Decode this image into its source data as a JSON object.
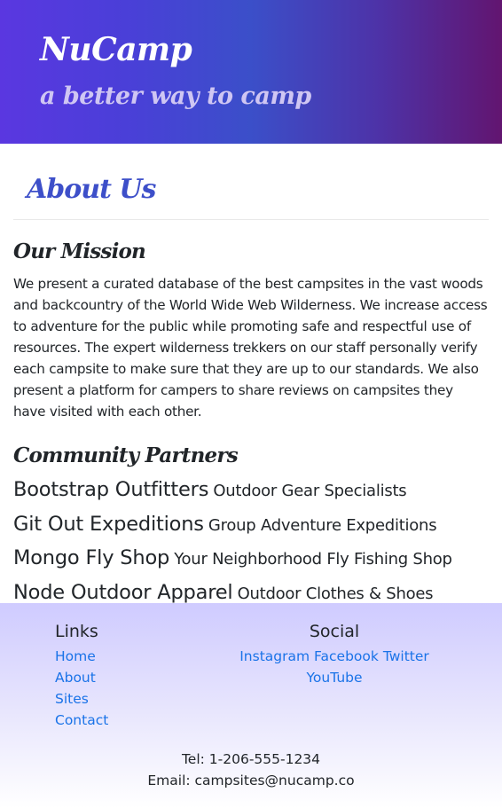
{
  "header": {
    "brand": "NuCamp",
    "tagline": "a better way to camp"
  },
  "main": {
    "title": "About Us",
    "mission": {
      "heading": "Our Mission",
      "text": "We present a curated database of the best campsites in the vast woods and backcountry of the World Wide Web Wilderness. We increase access to adventure for the public while promoting safe and respectful use of resources. The expert wilderness trekkers on our staff personally verify each campsite to make sure that they are up to our standards. We also present a platform for campers to share reviews on campsites they have visited with each other."
    },
    "partners": {
      "heading": "Community Partners",
      "items": [
        {
          "name": "Bootstrap Outfitters",
          "description": "Outdoor Gear Specialists"
        },
        {
          "name": "Git Out Expeditions",
          "description": "Group Adventure Expeditions"
        },
        {
          "name": "Mongo Fly Shop",
          "description": "Your Neighborhood Fly Fishing Shop"
        },
        {
          "name": "Node Outdoor Apparel",
          "description": "Outdoor Clothes & Shoes"
        }
      ]
    }
  },
  "footer": {
    "links_heading": "Links",
    "links": [
      "Home",
      "About",
      "Sites",
      "Contact"
    ],
    "social_heading": "Social",
    "social": [
      "Instagram",
      "Facebook",
      "Twitter",
      "YouTube"
    ],
    "tel": "Tel: 1-206-555-1234",
    "email": "Email: campsites@nucamp.co"
  },
  "colors": {
    "link": "#1a73e8",
    "title_accent": "#3d4fc9",
    "header_gradient_start": "#5a37e0",
    "header_gradient_end": "#621570",
    "footer_gradient_top": "#cfcbff"
  }
}
